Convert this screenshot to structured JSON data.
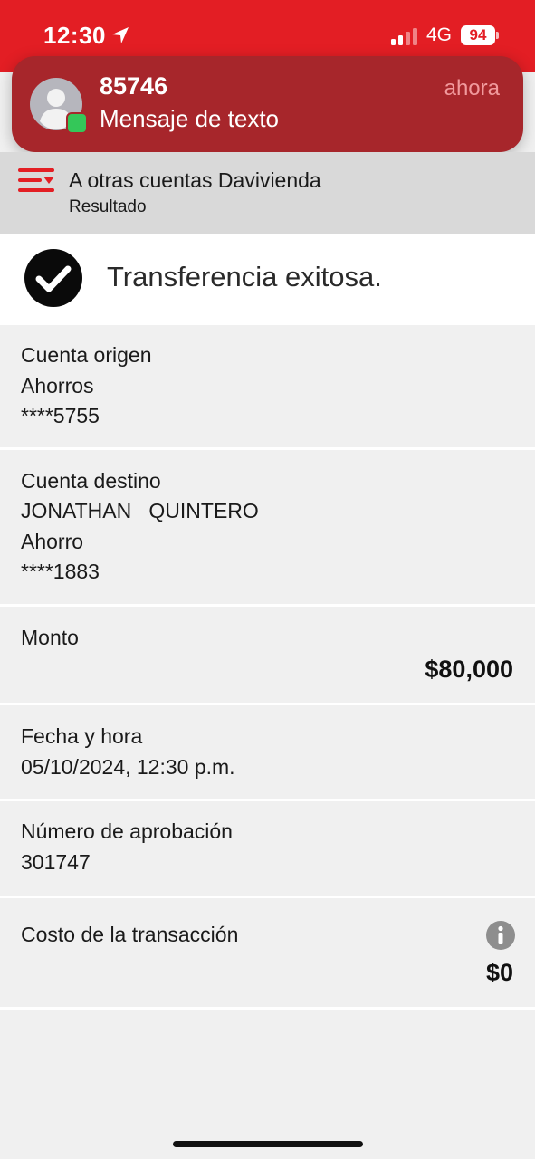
{
  "status_bar": {
    "time": "12:30",
    "network": "4G",
    "battery": "94"
  },
  "notification": {
    "sender": "85746",
    "message": "Mensaje de texto",
    "time": "ahora"
  },
  "header": {
    "title": "A otras cuentas Davivienda",
    "subtitle": "Resultado"
  },
  "result": {
    "message": "Transferencia exitosa."
  },
  "origin": {
    "label": "Cuenta origen",
    "account_type": "Ahorros",
    "account_number": "****5755"
  },
  "destination": {
    "label": "Cuenta destino",
    "name": "JONATHAN   QUINTERO",
    "account_type": "Ahorro",
    "account_number": "****1883"
  },
  "amount": {
    "label": "Monto",
    "value": "$80,000"
  },
  "date": {
    "label": "Fecha y hora",
    "value": "05/10/2024, 12:30 p.m."
  },
  "approval": {
    "label": "Número de aprobación",
    "value": "301747"
  },
  "cost": {
    "label": "Costo de la transacción",
    "value": "$0"
  },
  "colors": {
    "brand_red": "#e31e24",
    "notification_bg": "#a7262b",
    "header_gray": "#d9d9d9",
    "page_bg": "#f0f0f0"
  },
  "icons": {
    "location": "location-arrow-icon",
    "signal": "signal-icon",
    "menu": "menu-icon",
    "success": "check-circle-icon",
    "info": "info-icon"
  }
}
